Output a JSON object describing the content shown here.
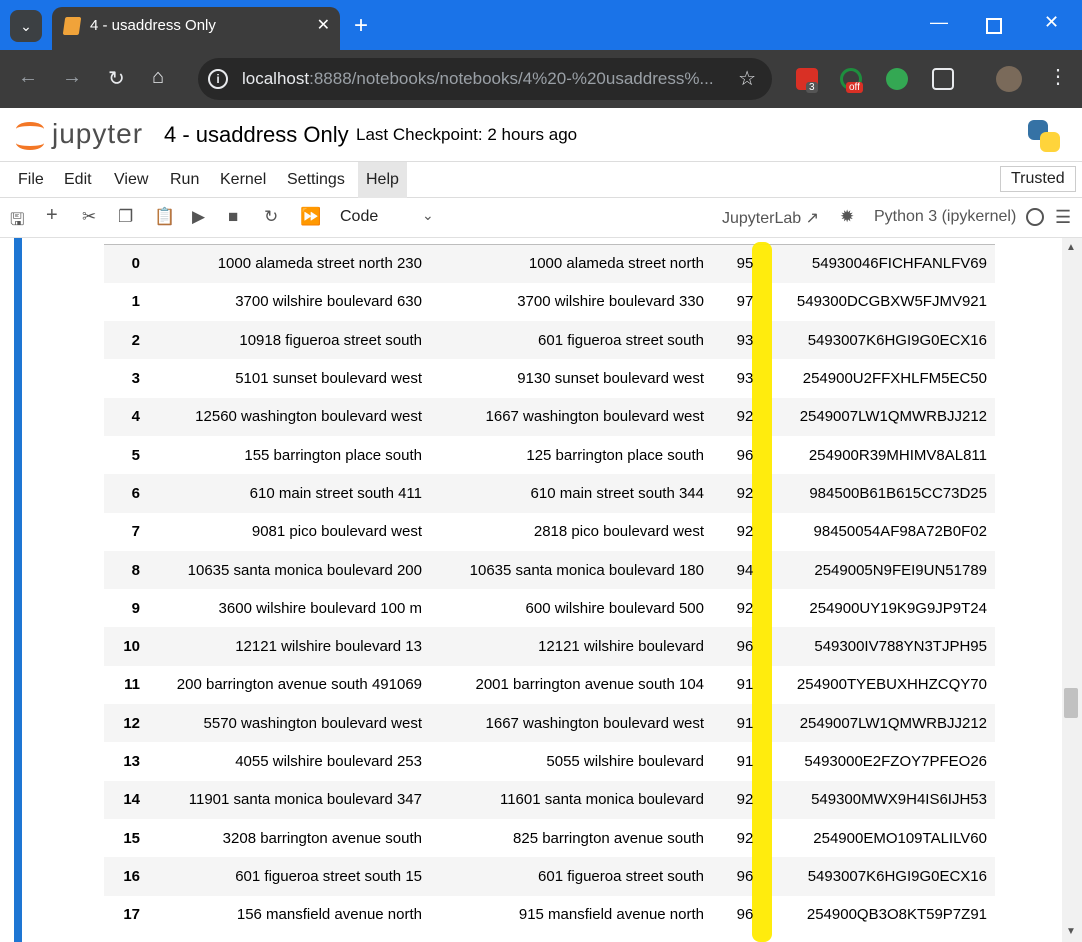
{
  "browser": {
    "tab_title": "4 - usaddress Only",
    "url_host": "localhost",
    "url_path": ":8888/notebooks/notebooks/4%20-%20usaddress%...",
    "ext_badge_1": "3",
    "ext_badge_2": "off",
    "colors": {
      "tabbar": "#1a73e8",
      "toolbar": "#3c3c3c"
    }
  },
  "jupyter": {
    "wordmark": "jupyter",
    "notebook_name": "4 - usaddress Only",
    "checkpoint": "Last Checkpoint: 2 hours ago",
    "trusted": "Trusted",
    "menu": [
      "File",
      "Edit",
      "View",
      "Run",
      "Kernel",
      "Settings",
      "Help"
    ],
    "cell_type": "Code",
    "jupyterlab_link": "JupyterLab",
    "kernel": "Python 3 (ipykernel)"
  },
  "table": {
    "rows": [
      {
        "idx": "0",
        "a": "1000 alameda street north 230",
        "b": "1000 alameda street north",
        "score": "95",
        "id": "54930046FICHFANLFV69"
      },
      {
        "idx": "1",
        "a": "3700 wilshire boulevard 630",
        "b": "3700 wilshire boulevard 330",
        "score": "97",
        "id": "549300DCGBXW5FJMV921"
      },
      {
        "idx": "2",
        "a": "10918 figueroa street south",
        "b": "601 figueroa street south",
        "score": "93",
        "id": "5493007K6HGI9G0ECX16"
      },
      {
        "idx": "3",
        "a": "5101 sunset boulevard west",
        "b": "9130 sunset boulevard west",
        "score": "93",
        "id": "254900U2FFXHLFM5EC50"
      },
      {
        "idx": "4",
        "a": "12560 washington boulevard west",
        "b": "1667 washington boulevard west",
        "score": "92",
        "id": "2549007LW1QMWRBJJ212"
      },
      {
        "idx": "5",
        "a": "155 barrington place south",
        "b": "125 barrington place south",
        "score": "96",
        "id": "254900R39MHIMV8AL811"
      },
      {
        "idx": "6",
        "a": "610 main street south 411",
        "b": "610 main street south 344",
        "score": "92",
        "id": "984500B61B615CC73D25"
      },
      {
        "idx": "7",
        "a": "9081 pico boulevard west",
        "b": "2818 pico boulevard west",
        "score": "92",
        "id": "98450054AF98A72B0F02"
      },
      {
        "idx": "8",
        "a": "10635 santa monica boulevard 200",
        "b": "10635 santa monica boulevard 180",
        "score": "94",
        "id": "2549005N9FEI9UN51789"
      },
      {
        "idx": "9",
        "a": "3600 wilshire boulevard 100 m",
        "b": "600 wilshire boulevard 500",
        "score": "92",
        "id": "254900UY19K9G9JP9T24"
      },
      {
        "idx": "10",
        "a": "12121 wilshire boulevard 13",
        "b": "12121 wilshire boulevard",
        "score": "96",
        "id": "549300IV788YN3TJPH95"
      },
      {
        "idx": "11",
        "a": "200 barrington avenue south 491069",
        "b": "2001 barrington avenue south 104",
        "score": "91",
        "id": "254900TYEBUXHHZCQY70"
      },
      {
        "idx": "12",
        "a": "5570 washington boulevard west",
        "b": "1667 washington boulevard west",
        "score": "91",
        "id": "2549007LW1QMWRBJJ212"
      },
      {
        "idx": "13",
        "a": "4055 wilshire boulevard 253",
        "b": "5055 wilshire boulevard",
        "score": "91",
        "id": "5493000E2FZOY7PFEO26"
      },
      {
        "idx": "14",
        "a": "11901 santa monica boulevard 347",
        "b": "11601 santa monica boulevard",
        "score": "92",
        "id": "549300MWX9H4IS6IJH53"
      },
      {
        "idx": "15",
        "a": "3208 barrington avenue south",
        "b": "825 barrington avenue south",
        "score": "92",
        "id": "254900EMO109TALILV60"
      },
      {
        "idx": "16",
        "a": "601 figueroa street south 15",
        "b": "601 figueroa street south",
        "score": "96",
        "id": "5493007K6HGI9G0ECX16"
      },
      {
        "idx": "17",
        "a": "156 mansfield avenue north",
        "b": "915 mansfield avenue north",
        "score": "96",
        "id": "254900QB3O8KT59P7Z91"
      }
    ]
  }
}
